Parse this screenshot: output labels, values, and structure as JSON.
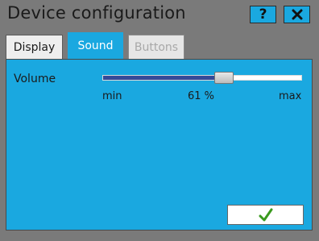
{
  "window": {
    "title": "Device configuration",
    "help_label": "?",
    "close_icon": "close-icon"
  },
  "tabs": [
    {
      "label": "Display",
      "state": "inactive"
    },
    {
      "label": "Sound",
      "state": "active"
    },
    {
      "label": "Buttons",
      "state": "disabled"
    }
  ],
  "sound": {
    "volume_label": "Volume",
    "volume_percent": 61,
    "volume_text": "61 %",
    "min_label": "min",
    "max_label": "max"
  },
  "ok_button": {
    "icon": "checkmark-icon"
  },
  "colors": {
    "accent": "#1aa8e0",
    "slider_fill": "#344a98",
    "check": "#3a9a1e"
  }
}
